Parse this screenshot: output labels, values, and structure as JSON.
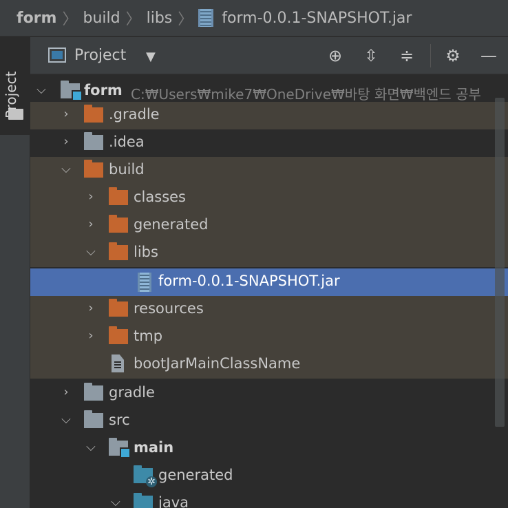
{
  "breadcrumb": {
    "items": [
      "form",
      "build",
      "libs"
    ],
    "file": "form-0.0.1-SNAPSHOT.jar"
  },
  "sidebar": {
    "tab_label": "Project"
  },
  "panel": {
    "title": "Project",
    "icons": [
      "locate-icon",
      "expand-all-icon",
      "collapse-all-icon",
      "gear-icon",
      "minimize-icon"
    ]
  },
  "tree": {
    "root": {
      "name": "form",
      "path": "C:₩Users₩mike7₩OneDrive₩바탕 화면₩백엔드 공부"
    },
    "items": [
      {
        "name": ".gradle"
      },
      {
        "name": ".idea"
      },
      {
        "name": "build"
      },
      {
        "name": "classes"
      },
      {
        "name": "generated"
      },
      {
        "name": "libs"
      },
      {
        "name": "form-0.0.1-SNAPSHOT.jar"
      },
      {
        "name": "resources"
      },
      {
        "name": "tmp"
      },
      {
        "name": "bootJarMainClassName"
      },
      {
        "name": "gradle"
      },
      {
        "name": "src"
      },
      {
        "name": "main"
      },
      {
        "name": "generated"
      },
      {
        "name": "java"
      }
    ]
  },
  "colors": {
    "selection": "#4b6eaf",
    "ignored_row": "#45413a",
    "excluded_folder": "#c4662f"
  }
}
